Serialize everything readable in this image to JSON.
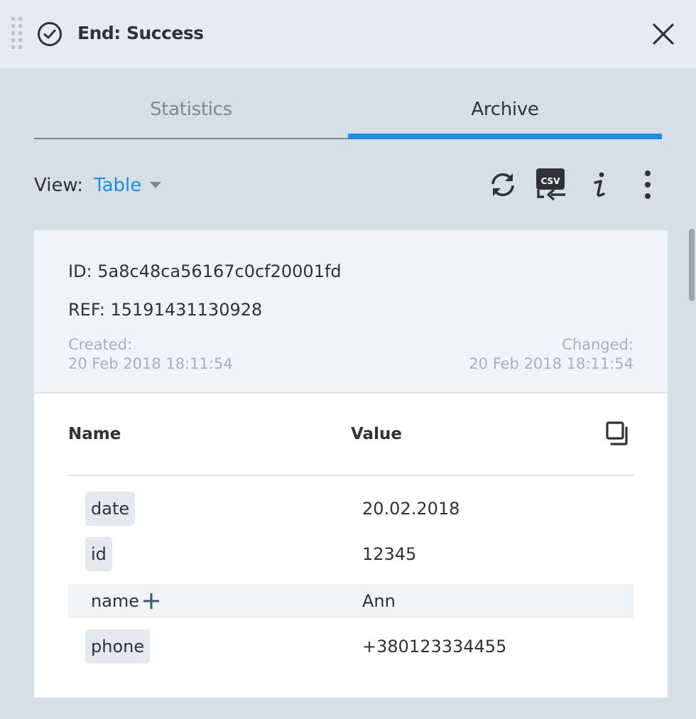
{
  "header": {
    "title": "End: Success"
  },
  "tabs": [
    {
      "label": "Statistics",
      "active": false
    },
    {
      "label": "Archive",
      "active": true
    }
  ],
  "toolbar": {
    "view_label": "View:",
    "view_value": "Table",
    "icons": [
      "refresh-icon",
      "csv-export-icon",
      "info-icon",
      "more-vertical-icon"
    ],
    "csv_badge": "CSV"
  },
  "record": {
    "id_line": "ID: 5a8c48ca56167c0cf20001fd",
    "ref_line": "REF: 15191431130928",
    "created_label": "Created:",
    "created_value": "20 Feb 2018 18:11:54",
    "changed_label": "Changed:",
    "changed_value": "20 Feb 2018 18:11:54"
  },
  "table": {
    "headers": {
      "name": "Name",
      "value": "Value"
    },
    "rows": [
      {
        "name": "date",
        "value": "20.02.2018"
      },
      {
        "name": "id",
        "value": "12345"
      },
      {
        "name": "name",
        "value": "Ann"
      },
      {
        "name": "phone",
        "value": "+380123334455"
      }
    ]
  },
  "colors": {
    "accent": "#1c8ee0",
    "header_bg": "#e4ecf2",
    "page_bg": "#d5dfe6"
  }
}
